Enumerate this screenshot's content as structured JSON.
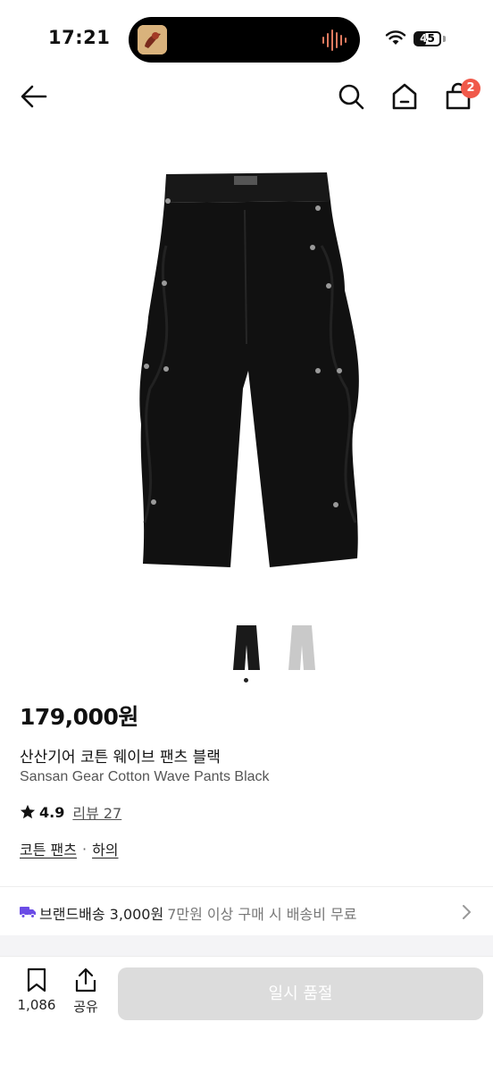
{
  "status_bar": {
    "time": "17:21",
    "battery": "45",
    "battery_level": 0.45
  },
  "nav": {
    "cart_count": "2"
  },
  "product": {
    "price": "179,000원",
    "name_kr": "산산기어 코튼 웨이브 팬츠 블랙",
    "name_en": "Sansan Gear Cotton Wave Pants Black",
    "rating": "4.9",
    "review_label": "리뷰 27",
    "categories": [
      "코튼 팬츠",
      "하의"
    ],
    "category_separator": "·",
    "thumbnail_colors": [
      "#1a1a1a",
      "#c9c9c9"
    ]
  },
  "shipping": {
    "main": "브랜드배송 3,000원",
    "sub": "7만원 이상 구매 시 배송비 무료"
  },
  "bottom_bar": {
    "bookmark_count": "1,086",
    "share_label": "공유",
    "soldout_label": "일시 품절"
  },
  "colors": {
    "badge": "#f0594a",
    "truck": "#6b4ce6",
    "soldout_bg": "#dcdcdc"
  }
}
